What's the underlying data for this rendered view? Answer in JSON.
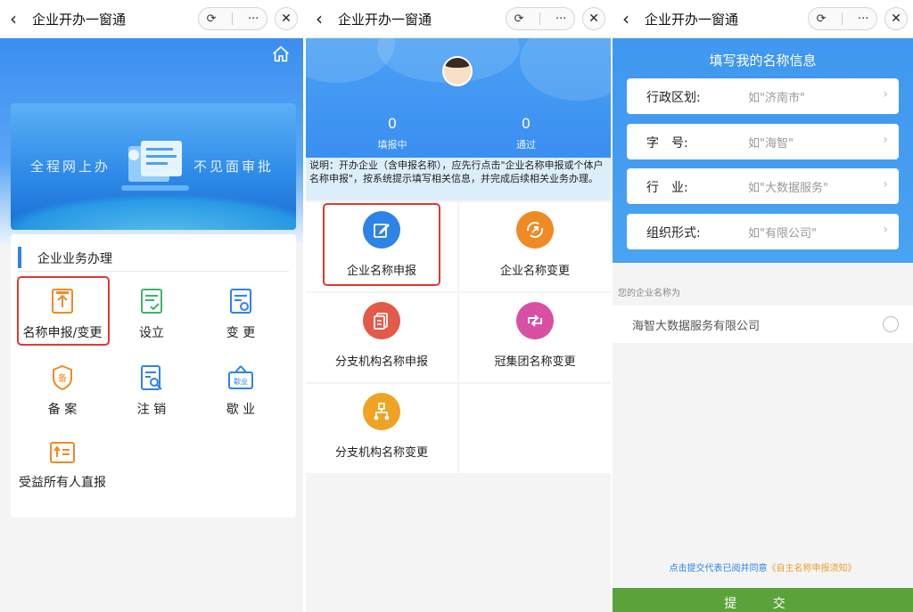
{
  "window_title": "企业开办一窗通",
  "capsule": {
    "refresh_icon": "refresh-icon",
    "more_label": "···",
    "close_label": "✕"
  },
  "panel1": {
    "banner_left": "全程网上办",
    "banner_right": "不见面审批",
    "section_title": "企业业务办理",
    "items": [
      {
        "label": "名称申报/变更",
        "icon": "upload-doc-icon",
        "color": "#f08a24"
      },
      {
        "label": "设立",
        "icon": "check-doc-icon",
        "color": "#3bb56a"
      },
      {
        "label": "变 更",
        "icon": "refresh-doc-icon",
        "color": "#2e83e6"
      },
      {
        "label": "备 案",
        "icon": "shield-icon",
        "color": "#f08a24"
      },
      {
        "label": "注 销",
        "icon": "search-doc-icon",
        "color": "#2e83e6"
      },
      {
        "label": "歇 业",
        "icon": "sign-icon",
        "color": "#2e83e6",
        "badge": "歇业"
      },
      {
        "label": "受益所有人直报",
        "icon": "list-icon",
        "color": "#f08a24"
      }
    ]
  },
  "panel2": {
    "stats": [
      {
        "num": "0",
        "cap": "填报中"
      },
      {
        "num": "0",
        "cap": "通过"
      }
    ],
    "note": "说明：开办企业（含申报名称），应先行点击\"企业名称申报或个体户名称申报\"，按系统提示填写相关信息，并完成后续相关业务办理。",
    "services": [
      {
        "label": "企业名称申报",
        "icon": "edit-icon",
        "color": "#2e83e6"
      },
      {
        "label": "企业名称变更",
        "icon": "swap-icon",
        "color": "#f08a24"
      },
      {
        "label": "分支机构名称申报",
        "icon": "document-icon",
        "color": "#e35a4a"
      },
      {
        "label": "冠集团名称变更",
        "icon": "arrows-icon",
        "color": "#d84fa4"
      },
      {
        "label": "分支机构名称变更",
        "icon": "branch-icon",
        "color": "#f0a323"
      }
    ]
  },
  "panel3": {
    "title": "填写我的名称信息",
    "fields": [
      {
        "label": "行政区划:",
        "placeholder": "如\"济南市\""
      },
      {
        "label": "字　号:",
        "placeholder": "如\"海智\""
      },
      {
        "label": "行　业:",
        "placeholder": "如\"大数据服务\""
      },
      {
        "label": "组织形式:",
        "placeholder": "如\"有限公司\""
      }
    ],
    "hint": "您的企业名称为",
    "company_name": "海智大数据服务有限公司",
    "agree_text": "点击提交代表已阅并同意",
    "agree_doc": "《自主名称申报须知》",
    "submit": "提 交"
  }
}
